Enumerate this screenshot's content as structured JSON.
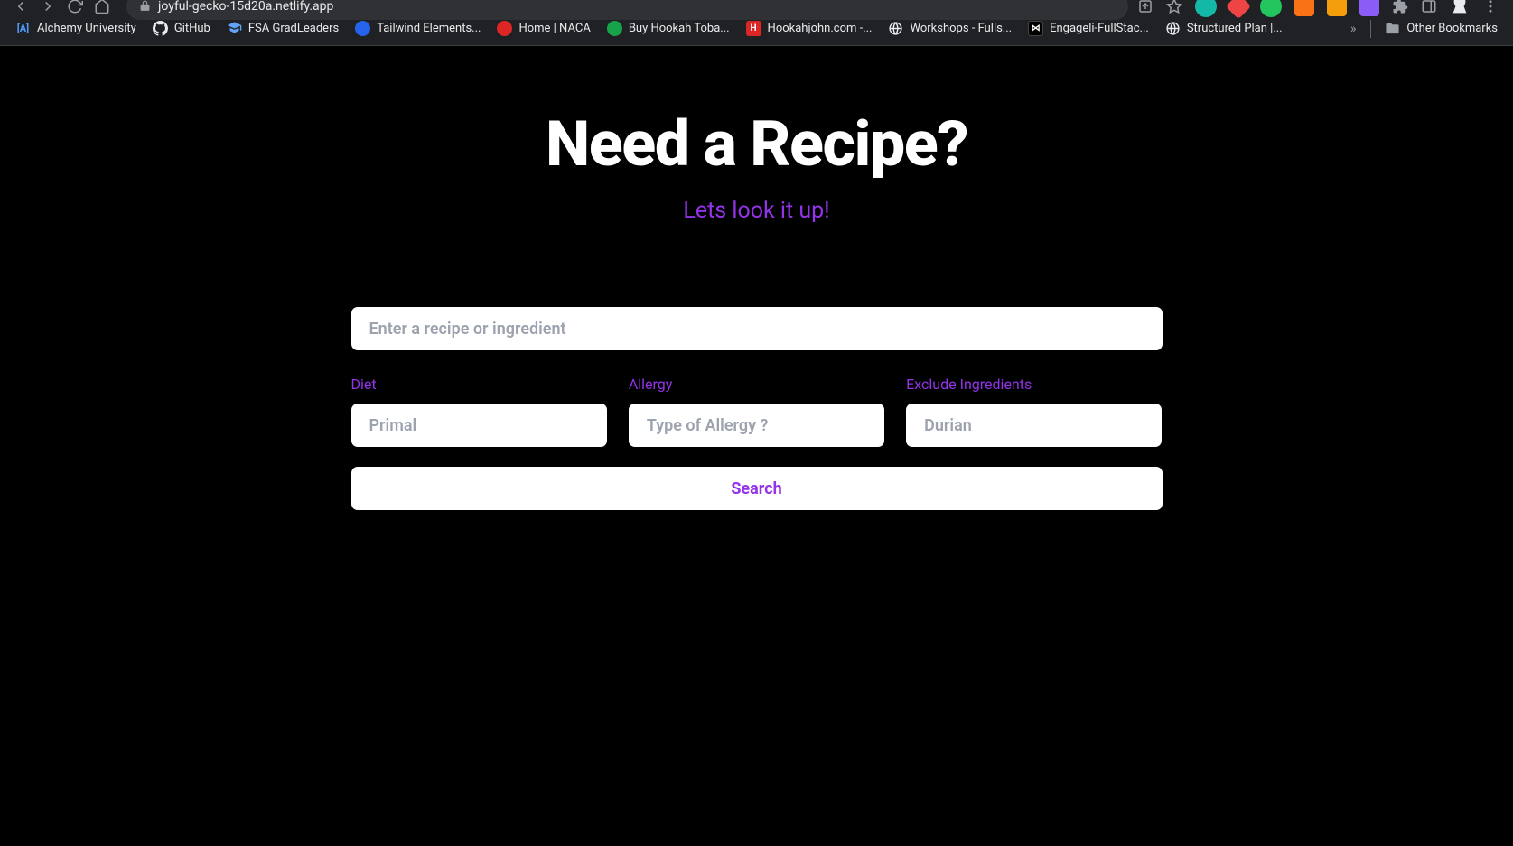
{
  "browser": {
    "url": "joyful-gecko-15d20a.netlify.app",
    "right_share_aria": "Share",
    "right_star_aria": "Bookmark",
    "overflow": "»",
    "other_bookmarks": "Other Bookmarks"
  },
  "bookmarks": [
    {
      "label": "Alchemy University",
      "icon_text": "[A]",
      "icon_bg": "transparent",
      "icon_color": "#4f9cf9"
    },
    {
      "label": "GitHub",
      "icon_svg": "github",
      "icon_bg": "#ffffff"
    },
    {
      "label": "FSA GradLeaders",
      "icon_svg": "grad",
      "icon_bg": "transparent"
    },
    {
      "label": "Tailwind Elements...",
      "icon_bg": "#2563eb",
      "icon_round": true
    },
    {
      "label": "Home | NACA",
      "icon_bg": "#dc2626",
      "icon_round": true
    },
    {
      "label": "Buy Hookah Toba...",
      "icon_bg": "#16a34a",
      "icon_round": true
    },
    {
      "label": "Hookahjohn.com -...",
      "icon_text": "H",
      "icon_bg": "#dc2626"
    },
    {
      "label": "Workshops - Fulls...",
      "icon_svg": "globe",
      "icon_bg": "transparent"
    },
    {
      "label": "Engageli-FullStac...",
      "icon_bg": "#000000",
      "icon_text": "⋈",
      "icon_color": "#ffffff"
    },
    {
      "label": "Structured Plan |...",
      "icon_svg": "globe",
      "icon_bg": "transparent"
    }
  ],
  "extensions": [
    {
      "color": "#14b8a6",
      "shape": "circle"
    },
    {
      "color": "#ef4444",
      "shape": "diamond"
    },
    {
      "color": "#22c55e",
      "shape": "circle"
    },
    {
      "color": "#f97316",
      "shape": "square"
    },
    {
      "color": "#f59e0b",
      "shape": "square"
    },
    {
      "color": "#8b5cf6",
      "shape": "square"
    }
  ],
  "page": {
    "title": "Need a Recipe?",
    "subtitle": "Lets look it up!",
    "main_placeholder": "Enter a recipe or ingredient",
    "fields": {
      "diet": {
        "label": "Diet",
        "placeholder": "Primal"
      },
      "allergy": {
        "label": "Allergy",
        "placeholder": "Type of Allergy ?"
      },
      "exclude": {
        "label": "Exclude Ingredients",
        "placeholder": "Durian"
      }
    },
    "search_button": "Search"
  }
}
